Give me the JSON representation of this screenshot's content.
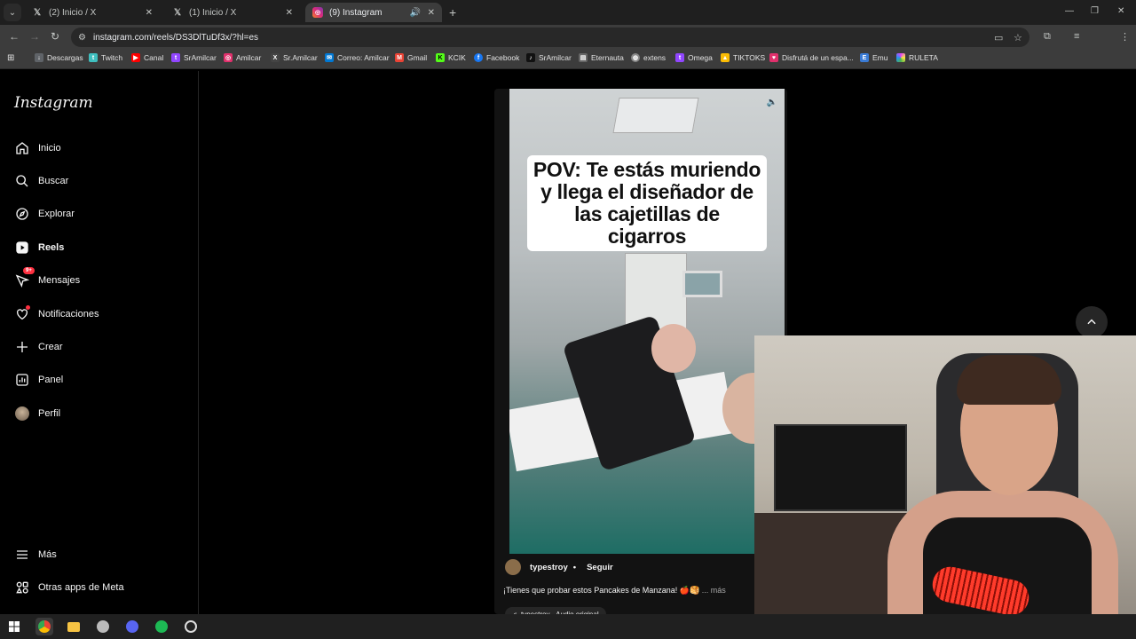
{
  "browser": {
    "tabs": [
      {
        "title": "(2) Inicio / X",
        "favicon": "x-logo-icon"
      },
      {
        "title": "(1) Inicio / X",
        "favicon": "x-logo-icon"
      },
      {
        "title": "(9) Instagram",
        "favicon": "instagram-icon",
        "active": true
      }
    ],
    "url": "instagram.com/reels/DS3DlTuDf3x/?hl=es",
    "bookmarks": [
      {
        "label": "Descargas",
        "icon": "download-icon",
        "color": "#5f6368"
      },
      {
        "label": "Twitch",
        "icon": "twitch-icon",
        "color": "#3fbfbf"
      },
      {
        "label": "Canal",
        "icon": "youtube-icon",
        "color": "#ff0000"
      },
      {
        "label": "SrAmilcar",
        "icon": "twitch-icon",
        "color": "#9146ff"
      },
      {
        "label": "Amilcar",
        "icon": "instagram-icon",
        "color": "#e1306c"
      },
      {
        "label": "Sr.Amilcar",
        "icon": "x-logo-icon",
        "color": "#444444"
      },
      {
        "label": "Correo: Amilcar",
        "icon": "mail-icon",
        "color": "#0078d4"
      },
      {
        "label": "Gmail",
        "icon": "gmail-icon",
        "color": "#ea4335"
      },
      {
        "label": "KCIK",
        "icon": "kick-icon",
        "color": "#53fc18"
      },
      {
        "label": "Facebook",
        "icon": "facebook-icon",
        "color": "#1877f2"
      },
      {
        "label": "SrAmilcar",
        "icon": "tiktok-icon",
        "color": "#111111"
      },
      {
        "label": "Eternauta",
        "icon": "page-icon",
        "color": "#666666"
      },
      {
        "label": "extens",
        "icon": "globe-icon",
        "color": "#888888"
      },
      {
        "label": "Omega",
        "icon": "twitch-icon",
        "color": "#9146ff"
      },
      {
        "label": "TIKTOKS",
        "icon": "drive-icon",
        "color": "#fbbc04"
      },
      {
        "label": "Disfrutá de un espa...",
        "icon": "heart-icon",
        "color": "#e1306c"
      },
      {
        "label": "Emu",
        "icon": "emu-icon",
        "color": "#3a7bd5"
      },
      {
        "label": "RULETA",
        "icon": "wheel-icon",
        "color": "#e040fb"
      }
    ]
  },
  "sidebar": {
    "logo": "Instagram",
    "items": [
      {
        "label": "Inicio",
        "icon": "home-icon"
      },
      {
        "label": "Buscar",
        "icon": "search-icon"
      },
      {
        "label": "Explorar",
        "icon": "compass-icon"
      },
      {
        "label": "Reels",
        "icon": "reels-icon",
        "active": true
      },
      {
        "label": "Mensajes",
        "icon": "messenger-icon",
        "badge": "9+"
      },
      {
        "label": "Notificaciones",
        "icon": "heart-icon",
        "dot": true
      },
      {
        "label": "Crear",
        "icon": "plus-icon"
      },
      {
        "label": "Panel",
        "icon": "chart-icon"
      },
      {
        "label": "Perfil",
        "icon": "avatar-icon"
      }
    ],
    "bottom": [
      {
        "label": "Más",
        "icon": "menu-icon"
      },
      {
        "label": "Otras apps de Meta",
        "icon": "meta-apps-icon"
      }
    ]
  },
  "reel": {
    "caption_lines": [
      "POV: Te estás muriendo",
      "y llega el diseñador de",
      "las cajetillas de cigarros"
    ],
    "author": "typestroy",
    "separator": "•",
    "follow": "Seguir",
    "description": "¡Tienes que probar estos Pancakes de Manzana! 🍎🥞",
    "more": "... más",
    "audio": "typestroy · Audio original"
  },
  "taskbar": {
    "apps": [
      "windows-start-icon",
      "chrome-icon",
      "file-explorer-icon",
      "app-icon",
      "discord-icon",
      "spotify-icon",
      "obs-icon"
    ]
  }
}
